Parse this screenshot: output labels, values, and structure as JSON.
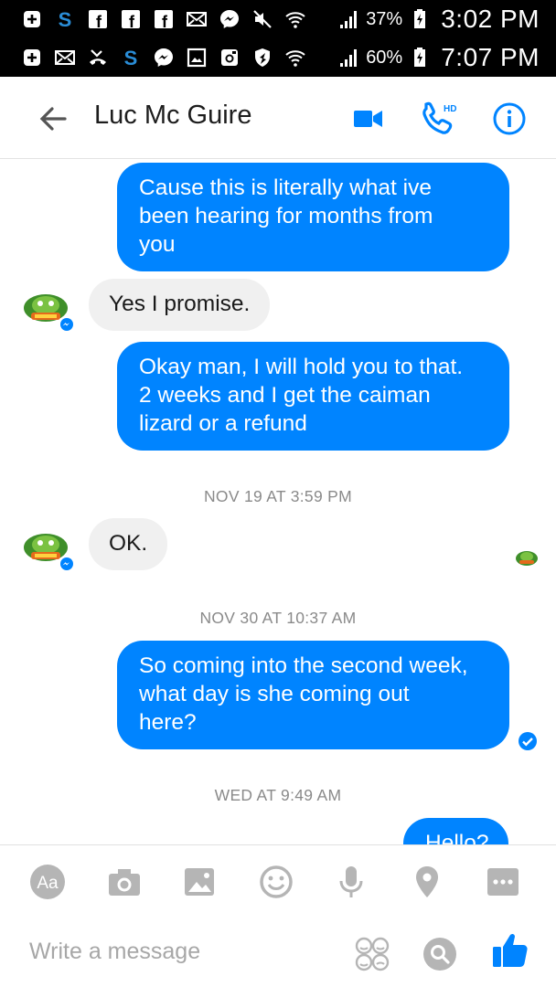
{
  "status_bar_top": {
    "battery_percent": "37%",
    "time": "3:02 PM",
    "icons": [
      "plus-box-icon",
      "skype-icon",
      "facebook-icon",
      "facebook-icon",
      "facebook-icon",
      "mail-icon",
      "messenger-icon",
      "mute-icon",
      "wifi-icon",
      "signal-icon",
      "battery-charging-icon"
    ]
  },
  "status_bar_bottom": {
    "battery_percent": "60%",
    "time": "7:07 PM",
    "icons": [
      "plus-box-icon",
      "mail-icon",
      "missed-call-icon",
      "skype-icon",
      "messenger-icon",
      "gallery-icon",
      "instagram-icon",
      "shield-icon",
      "wifi-icon",
      "signal-icon",
      "battery-charging-icon"
    ]
  },
  "header": {
    "contact_name": "Luc Mc Guire",
    "video_call_icon": "video-camera-icon",
    "voice_call_icon": "hd-phone-icon",
    "info_icon": "info-icon",
    "accent_color": "#0084ff"
  },
  "messages": [
    {
      "from": "me",
      "lines": [
        "Cause this is literally what ive",
        "been hearing for months from",
        "you"
      ]
    },
    {
      "from": "them",
      "lines": [
        "Yes I promise."
      ]
    },
    {
      "from": "me",
      "lines": [
        "Okay man, I will hold you to that.",
        "2 weeks and I get the caiman",
        "lizard or a refund"
      ]
    },
    {
      "type": "timestamp",
      "text": "NOV 19 AT 3:59 PM"
    },
    {
      "from": "them",
      "lines": [
        "OK."
      ]
    },
    {
      "type": "timestamp",
      "text": "NOV 30 AT 10:37 AM"
    },
    {
      "from": "me",
      "lines": [
        "So coming into the second week,",
        "what day is she coming out",
        "here?"
      ]
    },
    {
      "type": "timestamp",
      "text": "WED AT 9:49 AM"
    },
    {
      "from": "me",
      "lines": [
        "Hello?"
      ]
    }
  ],
  "composer": {
    "placeholder": "Write a message",
    "tools": [
      "text-aa-icon",
      "camera-icon",
      "image-icon",
      "emoji-icon",
      "microphone-icon",
      "location-pin-icon",
      "more-dots-icon"
    ],
    "aa_label": "Aa"
  },
  "colors": {
    "outgoing_bubble": "#0084ff",
    "incoming_bubble": "#f0f0f0"
  }
}
